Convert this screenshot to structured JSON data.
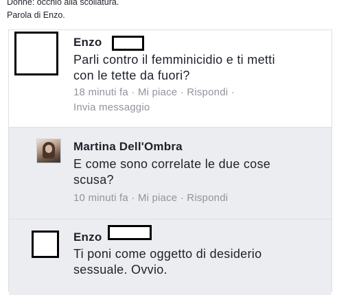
{
  "caption": {
    "line1": "Donne: occhio alla scollatura.",
    "line2": "Parola di Enzo."
  },
  "comments": [
    {
      "author": "Enzo",
      "text_line1": "Parli contro il femminicidio e ti metti",
      "text_line2": "con le tette da fuori?",
      "time": "18 minuti fa",
      "like": "Mi piace",
      "reply": "Rispondi",
      "message": "Invia messaggio"
    },
    {
      "author": "Martina Dell'Ombra",
      "text_line1": "E come sono correlate le due cose",
      "text_line2": "scusa?",
      "time": "10 minuti fa",
      "like": "Mi piace",
      "reply": "Rispondi"
    },
    {
      "author": "Enzo",
      "text_line1": "Ti poni come oggetto di desiderio",
      "text_line2": "sessuale. Ovvio."
    }
  ],
  "separator": " · ",
  "colors": {
    "text": "#1d2129",
    "meta": "#90949c",
    "reply_bg": "#ebedf0",
    "border": "#dcdee3"
  }
}
